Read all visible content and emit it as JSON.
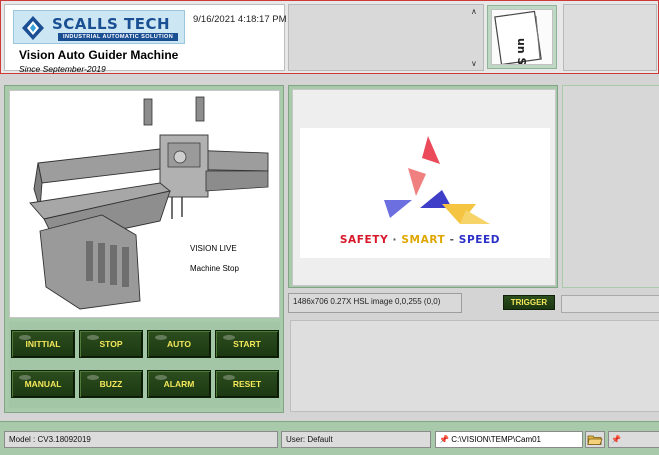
{
  "header": {
    "brand_name": "SCALLS TECH",
    "brand_tagline": "INDUSTRIAL AUTOMATIC SOLUTION",
    "datetime": "9/16/2021 4:18:17 PM",
    "machine_title": "Vision Auto Guider Machine",
    "since": "Since September-2019",
    "scroll_up_icon": "chevron-up-icon",
    "scroll_down_icon": "chevron-down-icon",
    "thumbnail_text": "un ST"
  },
  "machine_panel": {
    "vision_status": "VISION LIVE",
    "machine_status": "Machine Stop",
    "buttons_row1": [
      "INITTIAL",
      "STOP",
      "AUTO",
      "START"
    ],
    "buttons_row2": [
      "MANUAL",
      "BUZZ",
      "ALARM",
      "RESET"
    ]
  },
  "camera_panel": {
    "slogan_parts": [
      "SAFETY",
      " · ",
      "SMART",
      " - ",
      "SPEED"
    ],
    "slogan_colors": [
      "#d8182a",
      "#555555",
      "#e0a600",
      "#555555",
      "#2c2fc8"
    ],
    "image_info": "1486x706 0.27X HSL image 0,0,255    (0,0)",
    "trigger_label": "TRIGGER"
  },
  "status_bar": {
    "model": "Model : CV3.18092019",
    "user": "User:   Default",
    "path": "C:\\VISION\\TEMP\\Cam01",
    "folder_icon": "folder-open-icon"
  },
  "colors": {
    "panel_green": "#a9c9ab",
    "button_dark": "#1c3812",
    "button_text": "#f4e85a",
    "brand_blue": "#1a4f93",
    "header_border": "#cc3a3a"
  }
}
